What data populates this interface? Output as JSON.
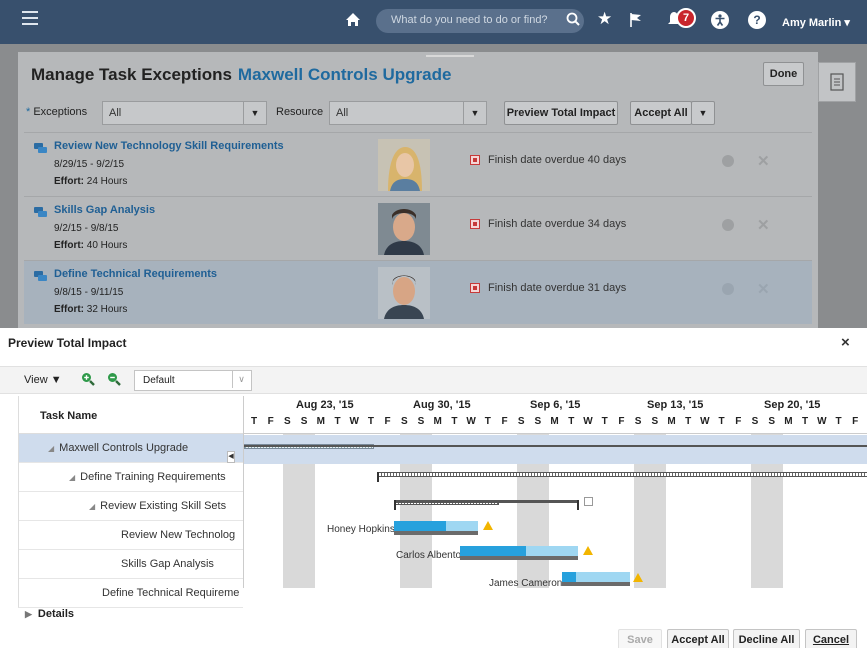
{
  "topbar": {
    "search_placeholder": "What do you need to do or find?",
    "notification_count": "7",
    "user_name": "Amy Marlin",
    "help": "?"
  },
  "page": {
    "title": "Manage Task Exceptions",
    "project": "Maxwell Controls Upgrade",
    "done_label": "Done",
    "filters": {
      "exceptions_label": "Exceptions",
      "exceptions_value": "All",
      "resource_label": "Resource",
      "resource_value": "All"
    },
    "preview_label": "Preview Total Impact",
    "accept_all_label": "Accept All",
    "exceptions": [
      {
        "title": "Review New Technology Skill Requirements",
        "dates": "8/29/15 - 9/2/15",
        "effort_label": "Effort:",
        "effort": "24 Hours",
        "message": "Finish date overdue 40 days"
      },
      {
        "title": "Skills Gap Analysis",
        "dates": "9/2/15 - 9/8/15",
        "effort_label": "Effort:",
        "effort": "40 Hours",
        "message": "Finish date overdue 34 days"
      },
      {
        "title": "Define Technical Requirements",
        "dates": "9/8/15 - 9/11/15",
        "effort_label": "Effort:",
        "effort": "32 Hours",
        "message": "Finish date overdue 31 days"
      }
    ]
  },
  "dialog": {
    "title": "Preview Total Impact",
    "close": "×",
    "view_label": "View",
    "layout_value": "Default",
    "task_name_header": "Task Name",
    "tasks": [
      "Maxwell Controls Upgrade",
      "Define Training Requirements",
      "Review Existing Skill Sets",
      "Review New Technolog",
      "Skills Gap Analysis",
      "Define Technical Requireme"
    ],
    "weeks": [
      "Aug 23, '15",
      "Aug 30, '15",
      "Sep 6, '15",
      "Sep 13, '15",
      "Sep 20, '15"
    ],
    "days": [
      "T",
      "F",
      "S",
      "S",
      "M",
      "T",
      "W",
      "T",
      "F",
      "S",
      "S",
      "M",
      "T",
      "W",
      "T",
      "F",
      "S",
      "S",
      "M",
      "T",
      "W",
      "T",
      "F",
      "S",
      "S",
      "M",
      "T",
      "W",
      "T",
      "F",
      "S",
      "S",
      "M",
      "T",
      "W",
      "T",
      "F",
      "S",
      "S",
      "M",
      "T",
      "W",
      "T",
      "I"
    ],
    "resources": [
      "Honey Hopkins",
      "Carlos Albento",
      "James Cameron"
    ],
    "details_label": "Details",
    "buttons": {
      "save": "Save",
      "accept_all": "Accept All",
      "decline_all": "Decline All",
      "cancel": "Cancel"
    }
  }
}
